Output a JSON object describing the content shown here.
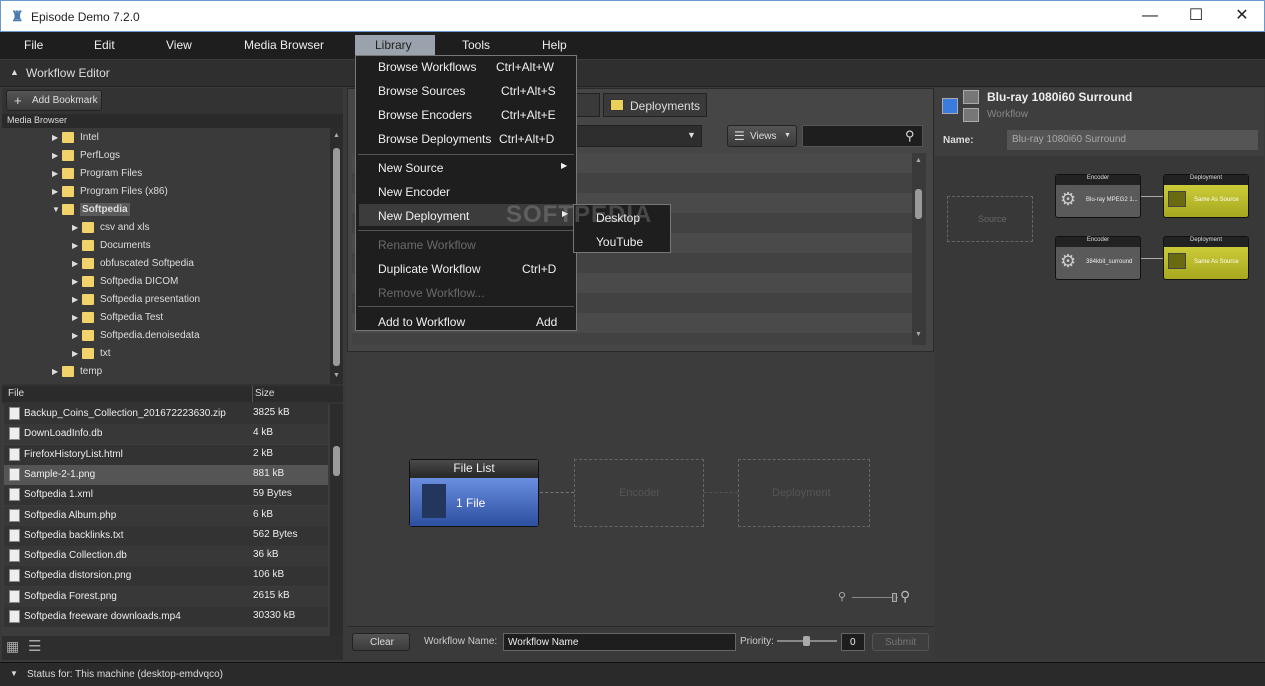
{
  "app": {
    "title": "Episode Demo 7.2.0"
  },
  "window": {
    "min": "—",
    "max": "☐",
    "close": "✕"
  },
  "menubar": [
    "File",
    "Edit",
    "View",
    "Media Browser",
    "Library",
    "Tools",
    "Help"
  ],
  "workflow_editor": {
    "title": "Workflow Editor",
    "add_bookmark": "Add Bookmark",
    "media_browser": "Media Browser"
  },
  "tree": [
    {
      "label": "Intel",
      "level": 0
    },
    {
      "label": "PerfLogs",
      "level": 0
    },
    {
      "label": "Program Files",
      "level": 0
    },
    {
      "label": "Program Files (x86)",
      "level": 0
    },
    {
      "label": "Softpedia",
      "level": 0,
      "expanded": true
    },
    {
      "label": "csv and xls",
      "level": 1
    },
    {
      "label": "Documents",
      "level": 1
    },
    {
      "label": "obfuscated Softpedia",
      "level": 1
    },
    {
      "label": "Softpedia DICOM",
      "level": 1
    },
    {
      "label": "Softpedia presentation",
      "level": 1
    },
    {
      "label": "Softpedia Test",
      "level": 1
    },
    {
      "label": "Softpedia.denoisedata",
      "level": 1
    },
    {
      "label": "txt",
      "level": 1
    },
    {
      "label": "temp",
      "level": 0
    }
  ],
  "files": {
    "col_file": "File",
    "col_size": "Size",
    "rows": [
      {
        "name": "Backup_Coins_Collection_201672223630.zip",
        "size": "3825 kB"
      },
      {
        "name": "DownLoadInfo.db",
        "size": "4 kB"
      },
      {
        "name": "FirefoxHistoryList.html",
        "size": "2 kB"
      },
      {
        "name": "Sample-2-1.png",
        "size": "881 kB"
      },
      {
        "name": "Softpedia 1.xml",
        "size": "59 Bytes"
      },
      {
        "name": "Softpedia Album.php",
        "size": "6 kB"
      },
      {
        "name": "Softpedia backlinks.txt",
        "size": "562 Bytes"
      },
      {
        "name": "Softpedia Collection.db",
        "size": "36 kB"
      },
      {
        "name": "Softpedia distorsion.png",
        "size": "106 kB"
      },
      {
        "name": "Softpedia Forest.png",
        "size": "2615 kB"
      },
      {
        "name": "Softpedia freeware downloads.mp4",
        "size": "30330 kB"
      }
    ]
  },
  "center": {
    "tab_encoders": "ders",
    "tab_deployments": "Deployments",
    "views": "Views",
    "file_list": "File List",
    "file_count": "1 File",
    "encoder": "Encoder",
    "deployment": "Deployment",
    "clear": "Clear",
    "workflow_name_label": "Workflow Name:",
    "workflow_name_value": "Workflow Name",
    "priority_label": "Priority:",
    "priority_value": "0",
    "submit": "Submit"
  },
  "right": {
    "title": "Blu-ray 1080i60 Surround",
    "subtitle": "Workflow",
    "name_label": "Name:",
    "name_value": "Blu-ray 1080i60 Surround",
    "source": "Source",
    "rows": [
      {
        "encoder": "Blu-ray MPEG2 1...",
        "deploy": "Same As Source"
      },
      {
        "encoder": "384kbit_surround",
        "deploy": "Same As Source"
      }
    ],
    "encoder_head": "Encoder",
    "deploy_head": "Deployment"
  },
  "menu": {
    "items": [
      {
        "label": "Browse Workflows",
        "shortcut": "Ctrl+Alt+W"
      },
      {
        "label": "Browse Sources",
        "shortcut": "Ctrl+Alt+S"
      },
      {
        "label": "Browse Encoders",
        "shortcut": "Ctrl+Alt+E"
      },
      {
        "label": "Browse Deployments",
        "shortcut": "Ctrl+Alt+D"
      },
      {
        "label": "New Source",
        "shortcut": ""
      },
      {
        "label": "New Encoder",
        "shortcut": ""
      },
      {
        "label": "New Deployment",
        "shortcut": ""
      },
      {
        "label": "Rename Workflow",
        "shortcut": ""
      },
      {
        "label": "Duplicate Workflow",
        "shortcut": "Ctrl+D"
      },
      {
        "label": "Remove Workflow...",
        "shortcut": ""
      },
      {
        "label": "Add to Workflow",
        "shortcut": "Add"
      }
    ],
    "submenu": [
      "Desktop",
      "YouTube"
    ]
  },
  "watermark": "SOFTPEDIA",
  "status": {
    "text": "Status for:  This machine (desktop-emdvqco)"
  }
}
